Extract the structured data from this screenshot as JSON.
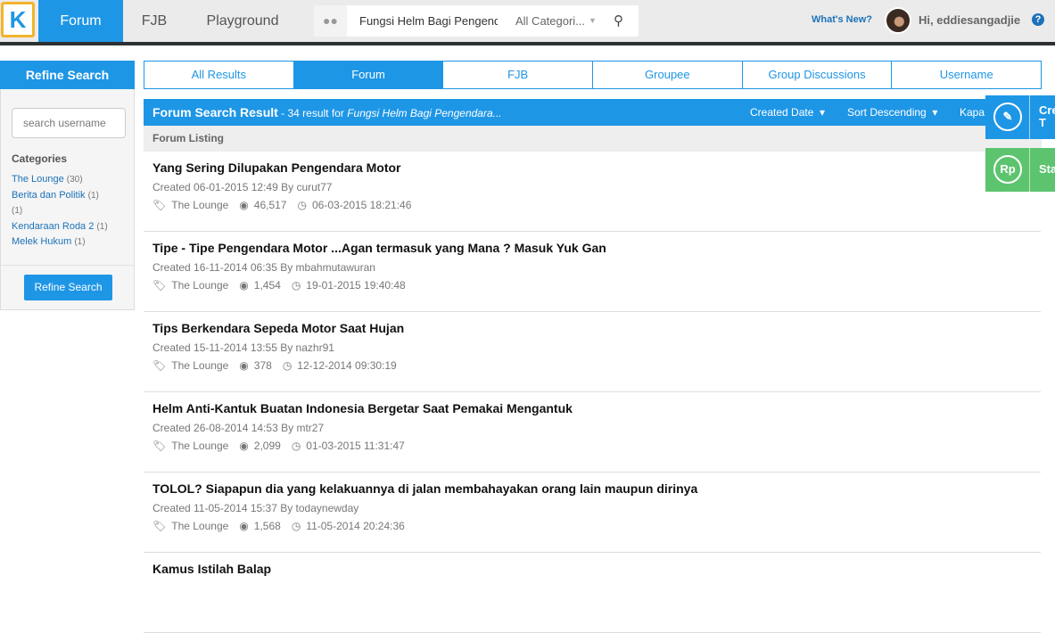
{
  "header": {
    "logo": "K",
    "nav": [
      "Forum",
      "FJB",
      "Playground"
    ],
    "search_query": "Fungsi Helm Bagi Pengendara",
    "category": "All Categori...",
    "whats_new": "What's New?",
    "greeting": "Hi, eddiesangadjie",
    "help": "?"
  },
  "sidebar": {
    "title": "Refine Search",
    "username_placeholder": "search username",
    "categories_title": "Categories",
    "categories": [
      {
        "name": "The Lounge",
        "count": "(30)"
      },
      {
        "name": "Berita dan Politik",
        "count": "(1)"
      },
      {
        "name": "",
        "count": "(1)"
      },
      {
        "name": "Kendaraan Roda 2",
        "count": "(1)"
      },
      {
        "name": "Melek Hukum",
        "count": "(1)"
      }
    ],
    "button": "Refine Search"
  },
  "tabs": [
    "All Results",
    "Forum",
    "FJB",
    "Groupee",
    "Group Discussions",
    "Username"
  ],
  "results": {
    "title": "Forum Search Result",
    "summary": " - 34 result for ",
    "query": "Fungsi Helm Bagi Pengendara...",
    "sort1": "Created Date",
    "sort2": "Sort Descending",
    "sort3": "Kapa",
    "listing": "Forum Listing",
    "items": [
      {
        "title": "Yang Sering Dilupakan Pengendara Motor",
        "created": "Created 06-01-2015 12:49 By curut77",
        "category": "The Lounge",
        "views": "46,517",
        "last": "06-03-2015 18:21:46"
      },
      {
        "title": "Tipe - Tipe Pengendara Motor ...Agan termasuk yang Mana ? Masuk Yuk Gan",
        "created": "Created 16-11-2014 06:35 By mbahmutawuran",
        "category": "The Lounge",
        "views": "1,454",
        "last": "19-01-2015 19:40:48"
      },
      {
        "title": "Tips Berkendara Sepeda Motor Saat Hujan",
        "created": "Created 15-11-2014 13:55 By nazhr91",
        "category": "The Lounge",
        "views": "378",
        "last": "12-12-2014 09:30:19"
      },
      {
        "title": "Helm Anti-Kantuk Buatan Indonesia Bergetar Saat Pemakai Mengantuk",
        "created": "Created 26-08-2014 14:53 By mtr27",
        "category": "The Lounge",
        "views": "2,099",
        "last": "01-03-2015 11:31:47"
      },
      {
        "title": "TOLOL? Siapapun dia yang kelakuannya di jalan membahayakan orang lain maupun dirinya",
        "created": "Created 11-05-2014 15:37 By todaynewday",
        "category": "The Lounge",
        "views": "1,568",
        "last": "11-05-2014 20:24:36"
      },
      {
        "title": "Kamus Istilah Balap",
        "created": "",
        "category": "",
        "views": "",
        "last": ""
      }
    ]
  },
  "floating": {
    "create": "Cre\nT",
    "create_icon": "pencil-icon",
    "sell": "Sta",
    "sell_icon": "Rp"
  },
  "colors": {
    "primary": "#1e96e6",
    "green": "#5cc46e",
    "logo_border": "#f3b32c"
  }
}
